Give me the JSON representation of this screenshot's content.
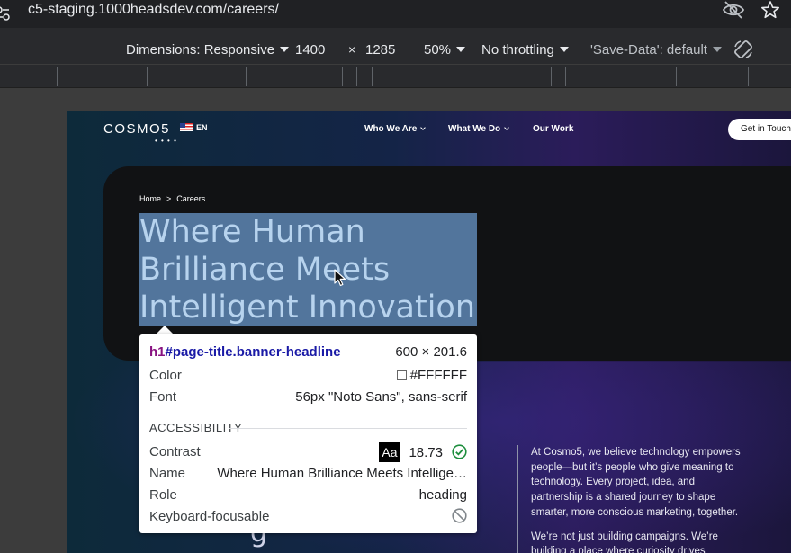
{
  "browser": {
    "url": "c5-staging.1000headsdev.com/careers/"
  },
  "device_toolbar": {
    "dimensions_label": "Dimensions: Responsive",
    "width": "1400",
    "times": "×",
    "height": "1285",
    "zoom": "50%",
    "throttling": "No throttling",
    "save_data": "'Save-Data': default"
  },
  "site": {
    "logo_text": "COSMO5",
    "logo_dots": "• • • •",
    "language": "EN",
    "nav": {
      "who_we_are": "Who We Are",
      "what_we_do": "What We Do",
      "our_work": "Our Work"
    },
    "cta": "Get in Touch",
    "breadcrumb": {
      "home": "Home",
      "sep": ">",
      "current": "Careers"
    },
    "headline": "Where Human Brilliance Meets Intelligent Innovation",
    "partial_glyph": "g",
    "about_p1": "At Cosmo5, we believe technology empowers people—but it’s people who give meaning to technology. Every project, idea, and partnership is a shared journey to shape smarter, more conscious marketing, together.",
    "about_p2": "We’re not just building campaigns. We’re building a place where curiosity drives"
  },
  "inspect_tooltip": {
    "tag": "h1",
    "selector": "#page-title.banner-headline",
    "size": "600 × 201.6",
    "color_label": "Color",
    "color_value": "#FFFFFF",
    "font_label": "Font",
    "font_value": "56px \"Noto Sans\", sans-serif",
    "accessibility_header": "ACCESSIBILITY",
    "contrast_label": "Contrast",
    "contrast_aa": "Aa",
    "contrast_value": "18.73",
    "name_label": "Name",
    "name_value": "Where Human Brilliance Meets Intellige…",
    "role_label": "Role",
    "role_value": "heading",
    "focusable_label": "Keyboard-focusable"
  },
  "colors": {
    "highlight": "#6897c9",
    "devtools_bg": "#292a2d",
    "tooltip_tag": "#881280",
    "tooltip_selector": "#1a1aa6",
    "contrast_pass": "#1e8e3e"
  }
}
